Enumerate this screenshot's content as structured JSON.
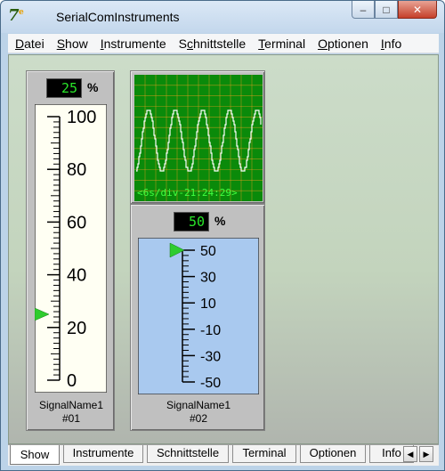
{
  "window": {
    "title": "SerialComInstruments",
    "icon": "app-logo-icon",
    "minimize_glyph": "–",
    "maximize_glyph": "□",
    "close_glyph": "✕"
  },
  "menu": [
    {
      "label": "Datei",
      "accel": "D"
    },
    {
      "label": "Show",
      "accel": "S"
    },
    {
      "label": "Instrumente",
      "accel": "I"
    },
    {
      "label": "Schnittstelle",
      "accel": "c"
    },
    {
      "label": "Terminal",
      "accel": "T"
    },
    {
      "label": "Optionen",
      "accel": "O"
    },
    {
      "label": "Info",
      "accel": "I"
    }
  ],
  "instruments": {
    "vertical_meter": {
      "value": "25",
      "unit": "%",
      "scale_labels": [
        "100",
        "80",
        "60",
        "40",
        "20",
        "0"
      ],
      "pointer_value": 25,
      "scale_min": 0,
      "scale_max": 100,
      "signal_name": "SignalName1",
      "instrument_id": "#01",
      "colors": {
        "face": "#fffff3",
        "pointer": "#2ecc2e"
      }
    },
    "oscilloscope": {
      "readout": "<6s/div-21:24:29>",
      "colors": {
        "background": "#0a8a0a",
        "grid": "#f0a020",
        "trace": "#ffffff",
        "readout": "#40ff40"
      }
    },
    "bar_meter": {
      "value": "50",
      "unit": "%",
      "scale_labels": [
        "50",
        "30",
        "10",
        "-10",
        "-30",
        "-50"
      ],
      "pointer_value": 50,
      "scale_min": -50,
      "scale_max": 50,
      "signal_name": "SignalName1",
      "instrument_id": "#02",
      "colors": {
        "face": "#a9c9ef",
        "pointer": "#2ecc2e"
      }
    }
  },
  "tabs": [
    "Show",
    "Instrumente",
    "Schnittstelle",
    "Terminal",
    "Optionen",
    "Info"
  ],
  "active_tab": "Show",
  "tab_scroll": {
    "left": "◀",
    "right": "▶"
  }
}
